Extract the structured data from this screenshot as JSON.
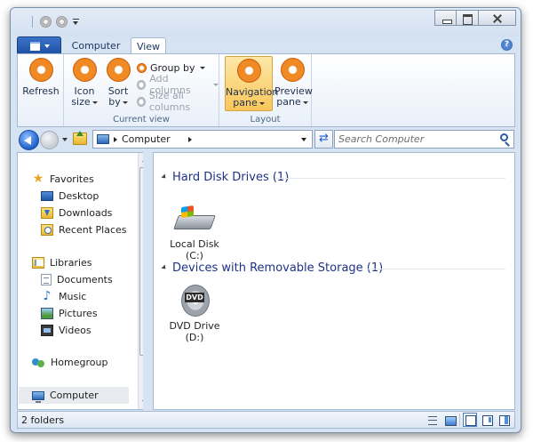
{
  "window": {
    "caption_buttons": [
      "minimize",
      "maximize",
      "close"
    ]
  },
  "ribbon": {
    "tabs": [
      {
        "label": "Computer",
        "selected": false
      },
      {
        "label": "View",
        "selected": true
      }
    ],
    "groups": {
      "current_view": {
        "label": "Current view",
        "refresh": {
          "label": "Refresh"
        },
        "icon_size": {
          "line1": "Icon",
          "line2": "size"
        },
        "sort_by": {
          "line1": "Sort",
          "line2": "by"
        },
        "group_by": {
          "label": "Group by",
          "enabled": true
        },
        "add_columns": {
          "label": "Add columns",
          "enabled": false
        },
        "size_all_columns": {
          "label": "Size all columns",
          "enabled": false
        }
      },
      "layout": {
        "label": "Layout",
        "navigation_pane": {
          "line1": "Navigation",
          "line2": "pane",
          "active": true
        },
        "preview_pane": {
          "line1": "Preview",
          "line2": "pane",
          "active": false
        }
      }
    }
  },
  "address_bar": {
    "location": "Computer",
    "search_placeholder": "Search Computer"
  },
  "nav_pane": {
    "favorites": {
      "label": "Favorites",
      "icon": "star-icon"
    },
    "favorite_items": [
      {
        "label": "Desktop",
        "icon": "desktop-icon"
      },
      {
        "label": "Downloads",
        "icon": "downloads-icon"
      },
      {
        "label": "Recent Places",
        "icon": "recent-places-icon"
      }
    ],
    "libraries": {
      "label": "Libraries",
      "icon": "libraries-icon"
    },
    "library_items": [
      {
        "label": "Documents",
        "icon": "documents-icon"
      },
      {
        "label": "Music",
        "icon": "music-icon"
      },
      {
        "label": "Pictures",
        "icon": "pictures-icon"
      },
      {
        "label": "Videos",
        "icon": "videos-icon"
      }
    ],
    "homegroup": {
      "label": "Homegroup",
      "icon": "homegroup-icon"
    },
    "computer": {
      "label": "Computer",
      "icon": "computer-icon",
      "selected": true
    }
  },
  "content": {
    "groups": [
      {
        "title": "Hard Disk Drives (1)",
        "items": [
          {
            "name": "Local Disk",
            "letter": "(C:)",
            "icon": "hard-disk-icon"
          }
        ]
      },
      {
        "title": "Devices with Removable Storage (1)",
        "items": [
          {
            "name": "DVD Drive",
            "letter": "(D:)",
            "icon": "dvd-drive-icon"
          }
        ]
      }
    ]
  },
  "status_bar": {
    "text": "2 folders",
    "view_buttons": [
      "details-view-icon",
      "tiles-view-icon",
      "no-pane-icon",
      "preview-pane-icon",
      "details-pane-icon"
    ]
  },
  "colors": {
    "accent_orange": "#f08a24",
    "group_header_blue": "#1e3287",
    "selection_highlight": "#f9c75a"
  }
}
